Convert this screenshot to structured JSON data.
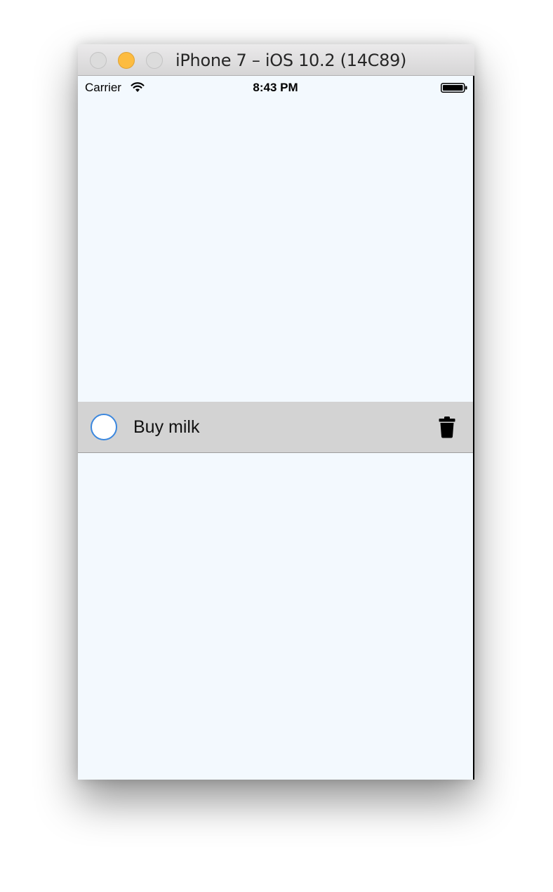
{
  "window": {
    "title": "iPhone 7 – iOS 10.2 (14C89)"
  },
  "statusbar": {
    "carrier": "Carrier",
    "time": "8:43 PM",
    "icons": [
      "wifi-icon",
      "battery-icon"
    ]
  },
  "todos": [
    {
      "text": "Buy milk",
      "completed": false,
      "icons": [
        "check-circle-icon",
        "trash-icon"
      ]
    }
  ],
  "colors": {
    "screen_background": "#f3f9fe",
    "row_background": "#d3d3d3",
    "checkbox_border": "#3b87de",
    "minimize_button": "#fdbc40"
  }
}
